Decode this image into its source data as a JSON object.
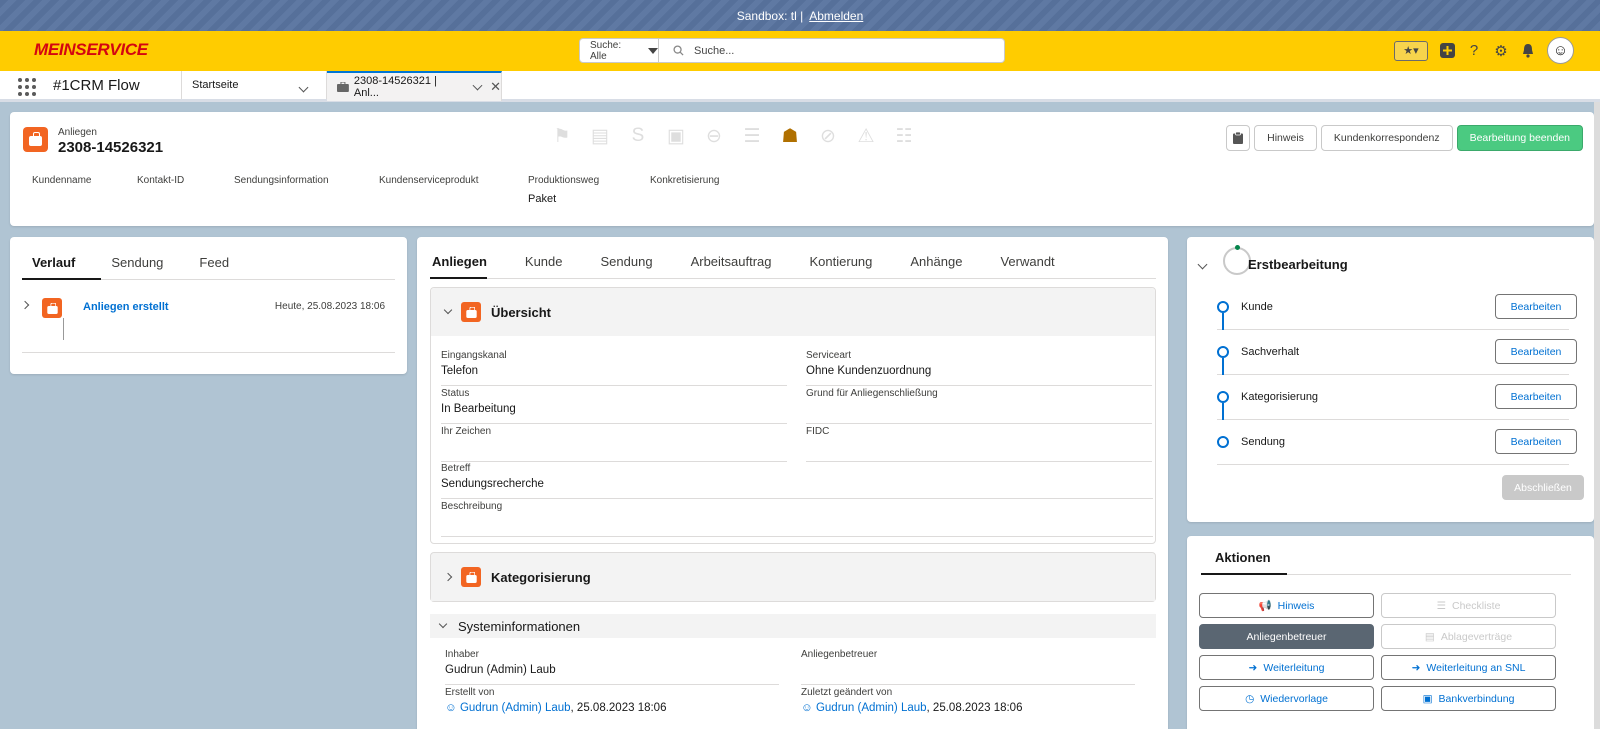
{
  "sandbox": {
    "text": "Sandbox: tl |",
    "logout": "Abmelden"
  },
  "header": {
    "brand": "MEINSERVICE",
    "search_scope": "Suche: Alle",
    "search_placeholder": "Suche..."
  },
  "nav": {
    "app_name": "#1CRM Flow",
    "home_tab": "Startseite",
    "record_tab": "2308-14526321 | Anl..."
  },
  "record": {
    "type": "Anliegen",
    "number": "2308-14526321",
    "buttons": {
      "hinweis": "Hinweis",
      "korrespondenz": "Kundenkorrespondenz",
      "beenden": "Bearbeitung beenden"
    },
    "highlights": [
      {
        "label": "Kundenname",
        "value": ""
      },
      {
        "label": "Kontakt-ID",
        "value": ""
      },
      {
        "label": "Sendungsinformation",
        "value": ""
      },
      {
        "label": "Kundenserviceprodukt",
        "value": ""
      },
      {
        "label": "Produktionsweg",
        "value": "Paket"
      },
      {
        "label": "Konkretisierung",
        "value": ""
      }
    ]
  },
  "left": {
    "tabs": [
      "Verlauf",
      "Sendung",
      "Feed"
    ],
    "timeline_title": "Anliegen erstellt",
    "timeline_date": "Heute, 25.08.2023 18:06"
  },
  "middle": {
    "tabs": [
      "Anliegen",
      "Kunde",
      "Sendung",
      "Arbeitsauftrag",
      "Kontierung",
      "Anhänge",
      "Verwandt"
    ],
    "overview_title": "Übersicht",
    "fields": {
      "eingangskanal": {
        "label": "Eingangskanal",
        "value": "Telefon"
      },
      "serviceart": {
        "label": "Serviceart",
        "value": "Ohne Kundenzuordnung"
      },
      "status": {
        "label": "Status",
        "value": "In Bearbeitung"
      },
      "grund": {
        "label": "Grund für Anliegenschließung",
        "value": ""
      },
      "ihr_zeichen": {
        "label": "Ihr Zeichen",
        "value": ""
      },
      "fidc": {
        "label": "FIDC",
        "value": ""
      },
      "betreff": {
        "label": "Betreff",
        "value": "Sendungsrecherche"
      },
      "beschreibung": {
        "label": "Beschreibung",
        "value": ""
      }
    },
    "category_title": "Kategorisierung",
    "system_title": "Systeminformationen",
    "system": {
      "inhaber": {
        "label": "Inhaber",
        "value": "Gudrun (Admin) Laub"
      },
      "betreuer": {
        "label": "Anliegenbetreuer",
        "value": ""
      },
      "erstellt": {
        "label": "Erstellt von",
        "user": "Gudrun (Admin) Laub",
        "date": ", 25.08.2023 18:06"
      },
      "geaendert": {
        "label": "Zuletzt geändert von",
        "user": "Gudrun (Admin) Laub",
        "date": ", 25.08.2023 18:06"
      }
    }
  },
  "path": {
    "title": "Erstbearbeitung",
    "steps": [
      {
        "name": "Kunde",
        "button": "Bearbeiten"
      },
      {
        "name": "Sachverhalt",
        "button": "Bearbeiten"
      },
      {
        "name": "Kategorisierung",
        "button": "Bearbeiten"
      },
      {
        "name": "Sendung",
        "button": "Bearbeiten"
      }
    ],
    "close_button": "Abschließen"
  },
  "actions": {
    "tab": "Aktionen",
    "buttons": [
      {
        "label": "Hinweis",
        "icon": "megaphone-icon",
        "glyph": "📢",
        "state": "normal"
      },
      {
        "label": "Checkliste",
        "icon": "checklist-icon",
        "glyph": "☰",
        "state": "disabled"
      },
      {
        "label": "Anliegenbetreuer",
        "icon": "",
        "glyph": "",
        "state": "dark"
      },
      {
        "label": "Ablageverträge",
        "icon": "documents-icon",
        "glyph": "▤",
        "state": "disabled"
      },
      {
        "label": "Weiterleitung",
        "icon": "forward-icon",
        "glyph": "➜",
        "state": "normal"
      },
      {
        "label": "Weiterleitung an SNL",
        "icon": "forward-icon",
        "glyph": "➜",
        "state": "normal"
      },
      {
        "label": "Wiedervorlage",
        "icon": "clock-icon",
        "glyph": "◷",
        "state": "normal"
      },
      {
        "label": "Bankverbindung",
        "icon": "money-icon",
        "glyph": "▣",
        "state": "normal"
      }
    ]
  },
  "colors": {
    "accent": "#0070d2",
    "brand_yellow": "#ffcc00",
    "brand_red": "#d40511",
    "record_orange": "#f26522",
    "success": "#4bca81"
  }
}
